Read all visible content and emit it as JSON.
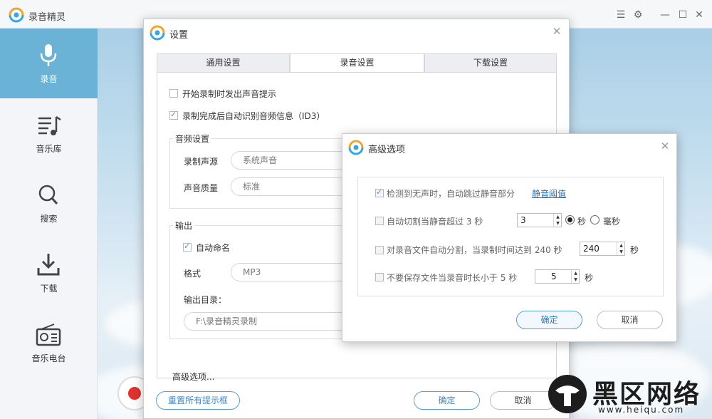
{
  "app": {
    "title": "录音精灵",
    "nav": [
      {
        "label": "录音",
        "icon": "microphone-icon"
      },
      {
        "label": "音乐库",
        "icon": "music-library-icon"
      },
      {
        "label": "搜索",
        "icon": "search-icon"
      },
      {
        "label": "下载",
        "icon": "download-icon"
      },
      {
        "label": "音乐电台",
        "icon": "radio-icon"
      }
    ]
  },
  "settings": {
    "title": "设置",
    "tabs": [
      "通用设置",
      "录音设置",
      "下载设置"
    ],
    "active_tab": "录音设置",
    "sound_prompt_label": "开始录制时发出声音提示",
    "sound_prompt_checked": false,
    "id3_label": "录制完成后自动识别音频信息（ID3）",
    "id3_checked": true,
    "audio": {
      "group_title": "音频设置",
      "source_label": "录制声源",
      "source_value": "系统声音",
      "quality_label": "声音质量",
      "quality_value": "标准"
    },
    "output": {
      "group_title": "输出",
      "auto_name_label": "自动命名",
      "auto_name_checked": true,
      "format_label": "格式",
      "format_value": "MP3",
      "dir_label": "输出目录：",
      "dir_value": "F:\\录音精灵录制"
    },
    "advanced_link": "高级选项...",
    "reset_button": "重置所有提示框",
    "ok_button": "确定",
    "cancel_button": "取消"
  },
  "advanced": {
    "title": "高级选项",
    "silence_skip_label": "检测到无声时，自动跳过静音部分",
    "silence_skip_checked": true,
    "threshold_link": "静音阈值",
    "auto_cut_label": "自动切割当静音超过 3 秒",
    "auto_cut_checked": false,
    "auto_cut_value": "3",
    "unit_sec": "秒",
    "unit_ms": "毫秒",
    "unit_selected": "秒",
    "split_label": "对录音文件自动分割，当录制时间达到 240 秒",
    "split_checked": false,
    "split_value": "240",
    "split_unit": "秒",
    "nosave_label": "不要保存文件当录音时长小于 5 秒",
    "nosave_checked": false,
    "nosave_value": "5",
    "nosave_unit": "秒",
    "ok_button": "确定",
    "cancel_button": "取消"
  },
  "watermark": {
    "text": "黑区网络",
    "url": "www.heiqu.com"
  },
  "colors": {
    "accent": "#6ab2d6",
    "record_red": "#e0322f",
    "link_blue": "#2f6fb0"
  }
}
